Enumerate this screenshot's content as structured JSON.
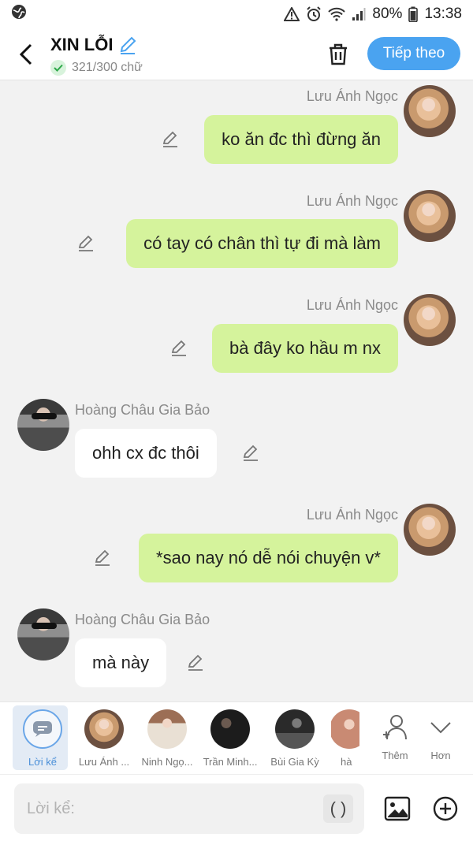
{
  "status_bar": {
    "battery": "80%",
    "time": "13:38"
  },
  "header": {
    "title": "XIN LỖI",
    "word_count": "321/300 chữ",
    "next_label": "Tiếp theo"
  },
  "messages": [
    {
      "side": "right",
      "sender": "Lưu Ánh Ngọc",
      "text": "ko ăn đc thì đừng ăn"
    },
    {
      "side": "right",
      "sender": "Lưu Ánh Ngọc",
      "text": "có tay có chân thì tự đi mà làm"
    },
    {
      "side": "right",
      "sender": "Lưu Ánh Ngọc",
      "text": "bà đây ko hầu m nx"
    },
    {
      "side": "left",
      "sender": "Hoàng Châu Gia Bảo",
      "text": "ohh cx đc thôi"
    },
    {
      "side": "right",
      "sender": "Lưu Ánh Ngọc",
      "text": "*sao nay nó dễ nói chuyện v*"
    },
    {
      "side": "left",
      "sender": "Hoàng Châu Gia Bảo",
      "text": "mà này"
    }
  ],
  "characters": [
    {
      "label": "Lời kể"
    },
    {
      "label": "Lưu Ánh ..."
    },
    {
      "label": "Ninh Ngọ..."
    },
    {
      "label": "Trần Minh..."
    },
    {
      "label": "Bùi Gia Kỳ"
    },
    {
      "label": "hà"
    }
  ],
  "more": {
    "add_label": "Thêm",
    "more_label": "Hơn"
  },
  "input": {
    "placeholder": "Lời kể:",
    "paren_label": "( )"
  }
}
